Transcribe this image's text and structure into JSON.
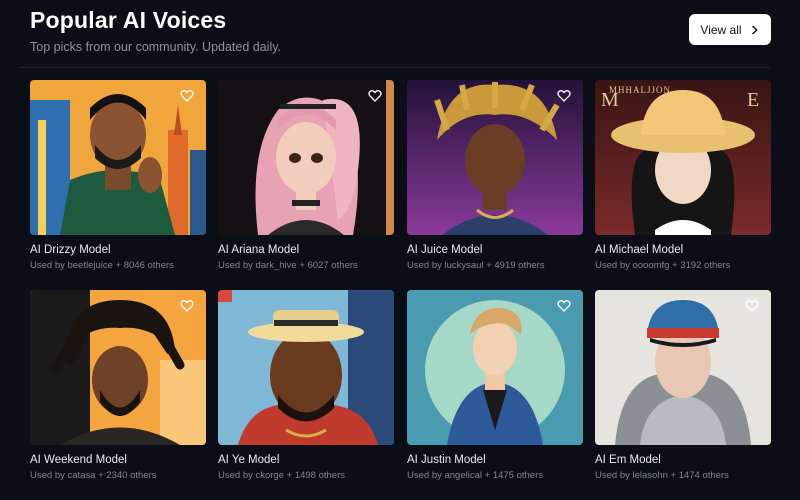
{
  "header": {
    "title": "Popular AI Voices",
    "subtitle": "Top picks from our community. Updated daily.",
    "view_all_label": "View all"
  },
  "voices": [
    {
      "name": "AI Drizzy Model",
      "used_by": "Used by beetlejuice + 8046 others",
      "bg": "#f0a63a"
    },
    {
      "name": "AI Ariana Model",
      "used_by": "Used by dark_hive + 6027 others",
      "bg": "#151012"
    },
    {
      "name": "AI Juice Model",
      "used_by": "Used by luckysaul + 4919 others",
      "bg": "#6a2a8a"
    },
    {
      "name": "AI Michael Model",
      "used_by": "Used by oooomfg + 3192 others",
      "bg": "#6a2424",
      "poster_text": "MHHALJJON"
    },
    {
      "name": "AI Weekend Model",
      "used_by": "Used by catasa + 2340 others",
      "bg": "#f4a540"
    },
    {
      "name": "AI Ye Model",
      "used_by": "Used by ckorge + 1498 others",
      "bg": "#7fb7d6"
    },
    {
      "name": "AI Justin Model",
      "used_by": "Used by angelical + 1475 others",
      "bg": "#4a9bb0"
    },
    {
      "name": "AI Em Model",
      "used_by": "Used by lelasohn + 1474 others",
      "bg": "#e6e4df"
    }
  ],
  "icons": {
    "view_all": "chevron-right-icon",
    "favorite": "heart-icon"
  }
}
